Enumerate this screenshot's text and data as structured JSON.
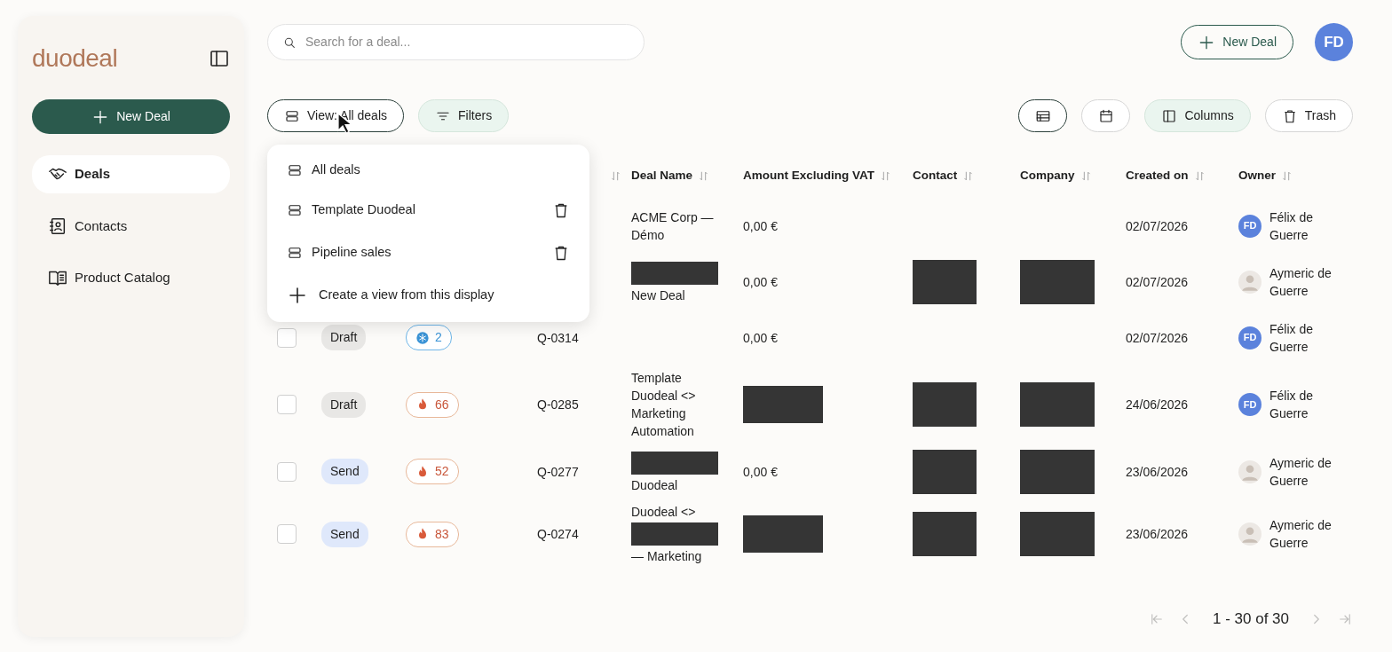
{
  "sidebar": {
    "logo": "duodeal",
    "new_button": "New Deal",
    "items": [
      {
        "label": "Deals",
        "selected": true
      },
      {
        "label": "Contacts",
        "selected": false
      },
      {
        "label": "Product Catalog",
        "selected": false
      }
    ]
  },
  "header": {
    "search": {
      "placeholder": "Search for a deal..."
    },
    "new_button": "New Deal",
    "user_initials": "FD"
  },
  "toolbar": {
    "view_button": "View: All deals",
    "filters_button": "Filters",
    "display_modes": [
      {
        "kind": "table",
        "selected": true
      },
      {
        "kind": "calendar",
        "selected": false
      }
    ],
    "columns_button": "Columns",
    "trash_button": "Trash"
  },
  "view_menu": {
    "items": [
      {
        "label": "All deals",
        "deletable": false
      },
      {
        "label": "Template Duodeal",
        "deletable": true
      },
      {
        "label": "Pipeline sales",
        "deletable": true
      }
    ],
    "create_action": "Create a view from this display"
  },
  "table": {
    "columns": [
      {
        "sortable": true
      },
      {
        "label": "Deal Name",
        "sortable": true
      },
      {
        "label": "Amount Excluding VAT",
        "sortable": true
      },
      {
        "label": "Contact",
        "sortable": true
      },
      {
        "label": "Company",
        "sortable": true
      },
      {
        "label": "Created on",
        "sortable": true
      },
      {
        "label": "Owner",
        "sortable": true
      }
    ],
    "rows": [
      {
        "deal_name": "ACME Corp — Démo",
        "amount": "0,00 €",
        "created": "02/07/2026",
        "owner": {
          "name": "Félix de Guerre",
          "initials": "FD"
        }
      },
      {
        "deal_name": {
          "redacted": true,
          "after": "New Deal"
        },
        "amount": "0,00 €",
        "contact": {
          "redacted": true
        },
        "company": {
          "redacted": true
        },
        "created": "02/07/2026",
        "owner": {
          "name": "Aymeric de Guerre"
        }
      },
      {
        "checked": false,
        "status": {
          "label": "Draft",
          "kind": "draft"
        },
        "score": {
          "kind": "cold",
          "value": "2"
        },
        "quote": "Q-0314",
        "amount": "0,00 €",
        "created": "02/07/2026",
        "owner": {
          "name": "Félix de Guerre",
          "initials": "FD"
        }
      },
      {
        "checked": false,
        "status": {
          "label": "Draft",
          "kind": "draft"
        },
        "score": {
          "kind": "hot",
          "value": "66"
        },
        "quote": "Q-0285",
        "deal_name": "Template Duodeal <> Marketing Automation",
        "amount": {
          "redacted": true
        },
        "contact": {
          "redacted": true
        },
        "company": {
          "redacted": true
        },
        "created": "24/06/2026",
        "owner": {
          "name": "Félix de Guerre",
          "initials": "FD"
        }
      },
      {
        "checked": false,
        "status": {
          "label": "Send",
          "kind": "sent"
        },
        "score": {
          "kind": "hot",
          "value": "52"
        },
        "quote": "Q-0277",
        "deal_name": {
          "redacted": true,
          "after": "Duodeal"
        },
        "amount": "0,00 €",
        "contact": {
          "redacted": true
        },
        "company": {
          "redacted": true
        },
        "created": "23/06/2026",
        "owner": {
          "name": "Aymeric de Guerre"
        }
      },
      {
        "checked": false,
        "status": {
          "label": "Send",
          "kind": "sent"
        },
        "score": {
          "kind": "hot",
          "value": "83"
        },
        "quote": "Q-0274",
        "deal_name": {
          "redacted": true,
          "before": "Duodeal <>",
          "after": "— Marketing"
        },
        "amount": {
          "redacted": true
        },
        "contact": {
          "redacted": true
        },
        "company": {
          "redacted": true
        },
        "created": "23/06/2026",
        "owner": {
          "name": "Aymeric de Guerre"
        }
      }
    ]
  },
  "pagination": {
    "text": "1 - 30 of 30",
    "previous_disabled": true,
    "next_disabled": true
  }
}
